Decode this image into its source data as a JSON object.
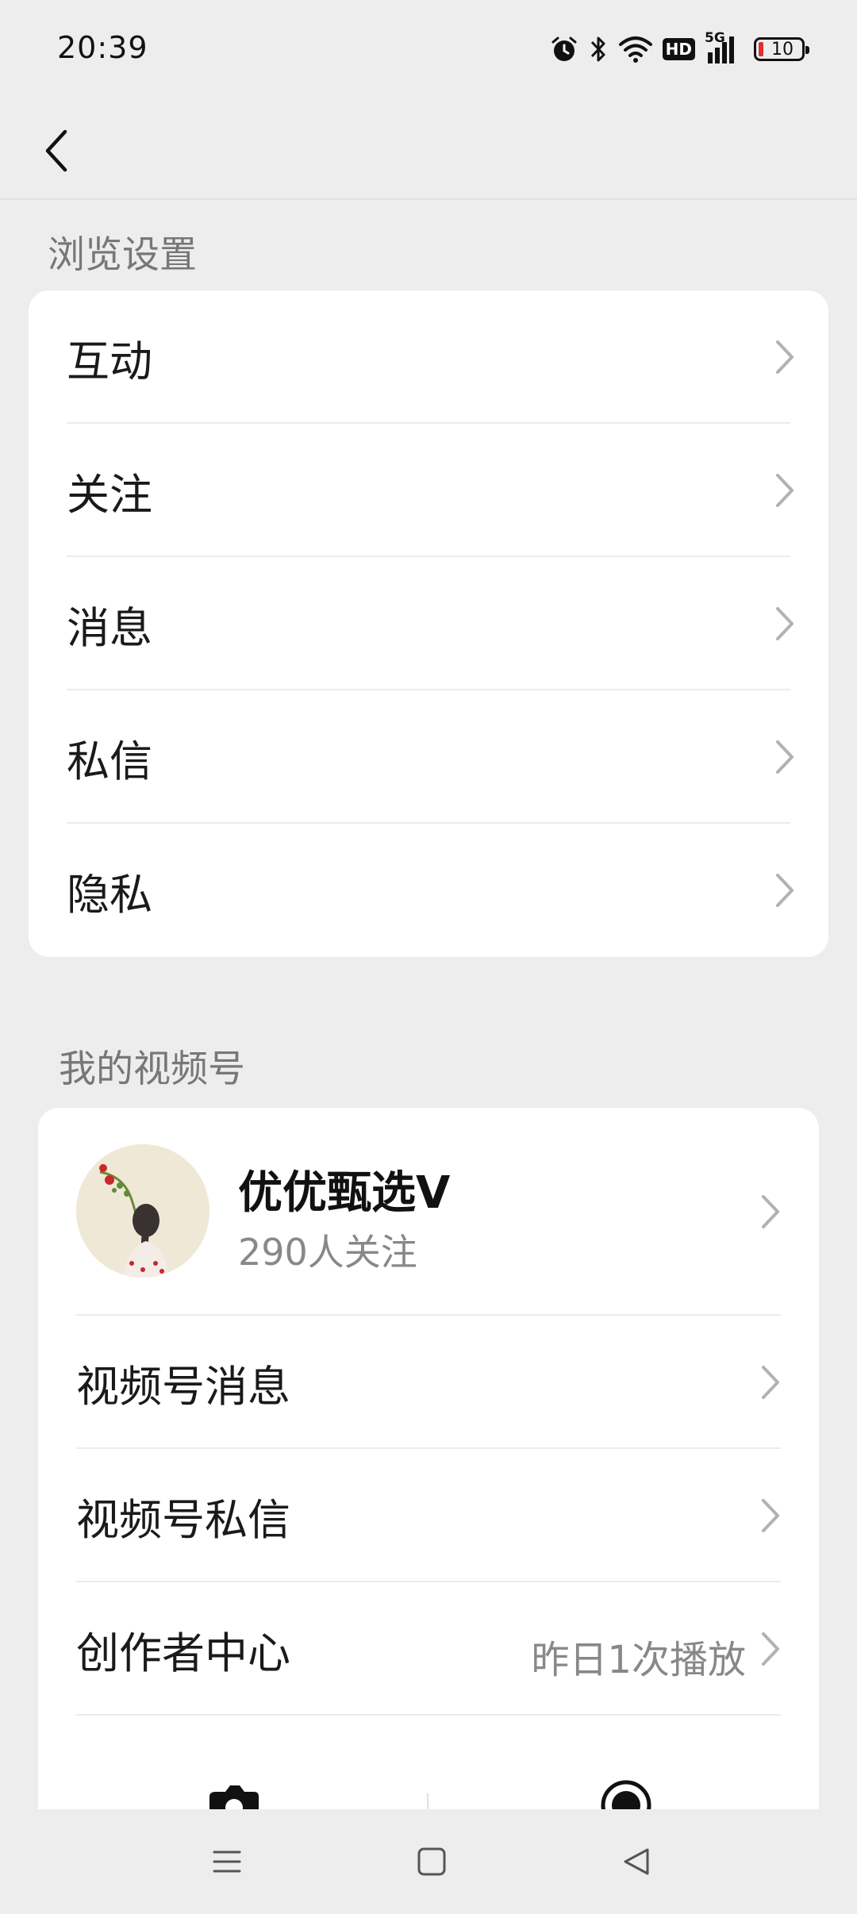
{
  "status_bar": {
    "time": "20:39",
    "icons": [
      "alarm-icon",
      "bluetooth-icon",
      "wifi-icon",
      "hd-icon",
      "signal-5g-icon",
      "battery-icon"
    ],
    "hd_label": "HD",
    "network_label": "5G",
    "battery_level": "10"
  },
  "nav": {
    "back_icon": "chevron-left-icon"
  },
  "browse_section": {
    "title": "浏览设置",
    "items": [
      {
        "label": "互动"
      },
      {
        "label": "关注"
      },
      {
        "label": "消息"
      },
      {
        "label": "私信"
      },
      {
        "label": "隐私"
      }
    ]
  },
  "channels_section": {
    "title": "我的视频号",
    "profile": {
      "name": "优优甄选V",
      "followers": "290人关注"
    },
    "items": [
      {
        "label": "视频号消息",
        "value": ""
      },
      {
        "label": "视频号私信",
        "value": ""
      },
      {
        "label": "创作者中心",
        "value": "昨日1次播放"
      }
    ]
  },
  "bottom_icons": [
    "camera-icon",
    "record-icon"
  ],
  "system_nav": [
    "menu-icon",
    "home-icon",
    "back-triangle-icon"
  ],
  "colors": {
    "background": "#ededed",
    "card": "#ffffff",
    "text": "#1a1a1a",
    "secondary": "#888888",
    "battery_low": "#e03030"
  }
}
